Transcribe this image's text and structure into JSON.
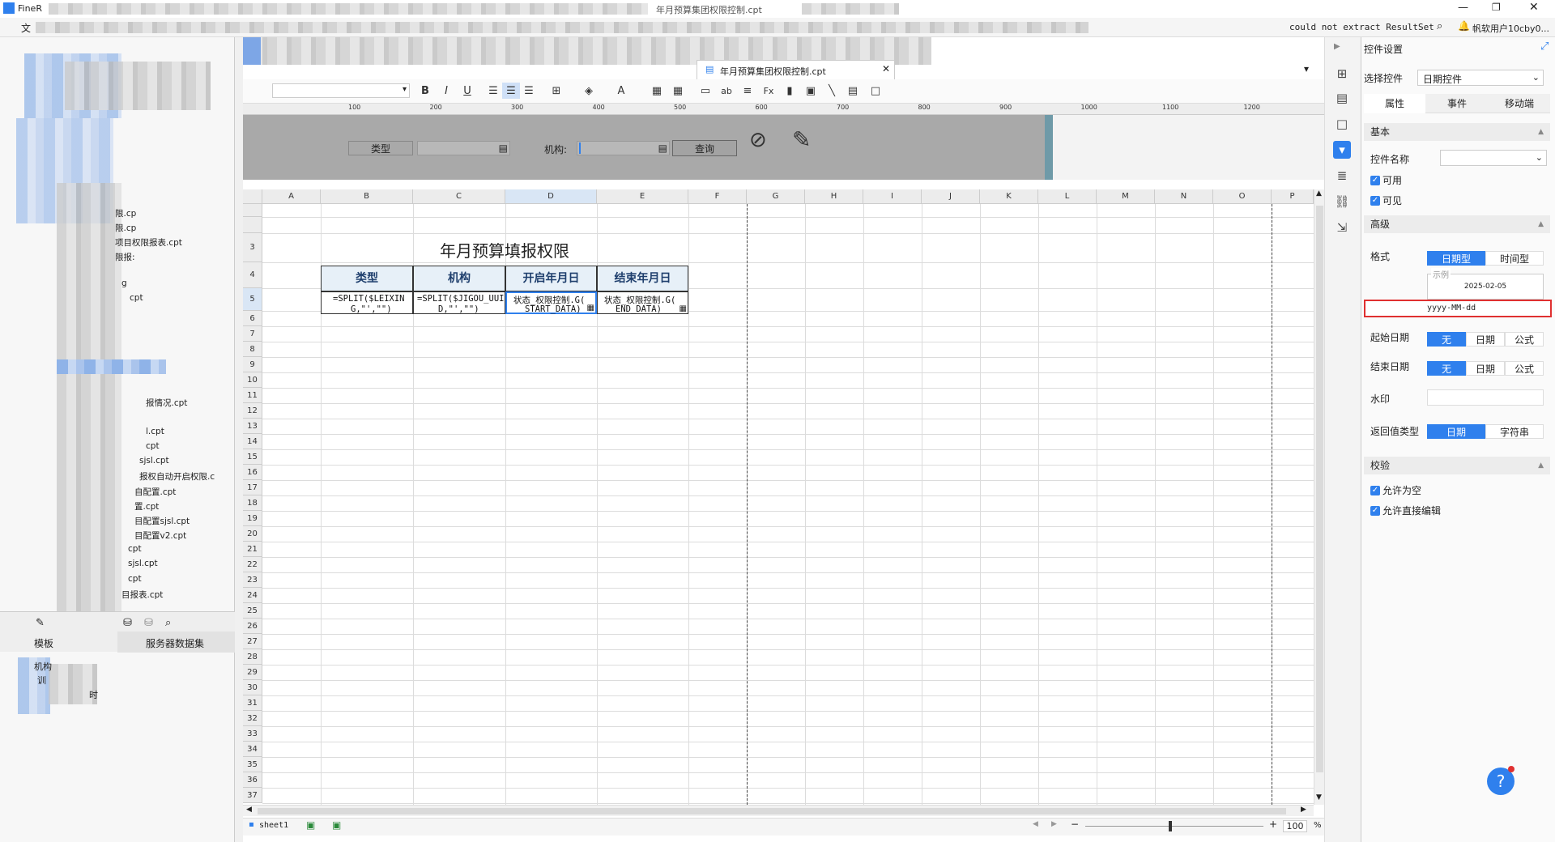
{
  "titlebar": {
    "app": "FineR",
    "title_fragment": "年月预算集团权限控制.cpt",
    "status": "could not extract ResultSet",
    "user": "帆软用户10cby0..."
  },
  "menubar": {
    "first": "文"
  },
  "tab": {
    "name": "年月预算集团权限控制.cpt"
  },
  "ruler": [
    "100",
    "200",
    "300",
    "400",
    "500",
    "600",
    "700",
    "800",
    "900",
    "1000",
    "1100",
    "1200"
  ],
  "param_pane": {
    "label_type": "类型",
    "label_org": "机构:",
    "query_button": "查询"
  },
  "columns": [
    "A",
    "B",
    "C",
    "D",
    "E",
    "F",
    "G",
    "H",
    "I",
    "J",
    "K",
    "L",
    "M",
    "N",
    "O",
    "P"
  ],
  "rows": [
    "",
    "",
    "3",
    "4",
    "5",
    "6",
    "7",
    "8",
    "9",
    "10",
    "11",
    "12",
    "13",
    "14",
    "15",
    "16",
    "17",
    "18",
    "19",
    "20",
    "21",
    "22",
    "23",
    "24",
    "25",
    "26",
    "27",
    "28",
    "29",
    "30",
    "31",
    "32",
    "33",
    "34",
    "35",
    "36",
    "37"
  ],
  "report": {
    "title": "年月预算填报权限",
    "headers": [
      "类型",
      "机构",
      "开启年月日",
      "结束年月日"
    ],
    "row5": [
      "=SPLIT($LEIXIN",
      "=SPLIT($JIGOU_UUI",
      "状态_权限控制.G(",
      "状态_权限控制.G("
    ],
    "row5b": [
      "G,\"',\"\")",
      "D,\"',\"\")",
      "START_DATA)",
      "END_DATA)"
    ]
  },
  "tree": [
    "限.cp",
    "限.cp",
    "项目权限报表.cpt",
    "限报:",
    "g",
    "cpt",
    "报情况.cpt",
    "l.cpt",
    "cpt",
    "sjsl.cpt",
    "报权自动开启权限.c",
    "自配置.cpt",
    "置.cpt",
    "目配置sjsl.cpt",
    "目配置v2.cpt",
    "cpt",
    "sjsl.cpt",
    "cpt",
    "目报表.cpt"
  ],
  "left_tabs": {
    "template": "模板",
    "server_dataset": "服务器数据集"
  },
  "bottom_tree": [
    "机构",
    "训",
    "时"
  ],
  "sheet": {
    "name": "sheet1",
    "zoom": "100",
    "percent": "%"
  },
  "props": {
    "title": "控件设置",
    "select_label": "选择控件",
    "select_value": "日期控件",
    "tabs": [
      "属性",
      "事件",
      "移动端"
    ],
    "basic": "基本",
    "name_label": "控件名称",
    "enabled": "可用",
    "visible": "可见",
    "advanced": "高级",
    "format_label": "格式",
    "format_opts": [
      "日期型",
      "时间型"
    ],
    "example_label": "示例",
    "example_value": "2025-02-05",
    "format_value": "yyyy-MM-dd",
    "start_label": "起始日期",
    "end_label": "结束日期",
    "date_opts": [
      "无",
      "日期",
      "公式"
    ],
    "watermark_label": "水印",
    "return_label": "返回值类型",
    "return_opts": [
      "日期",
      "字符串"
    ],
    "validate": "校验",
    "allow_empty": "允许为空",
    "allow_edit": "允许直接编辑"
  },
  "help": "?",
  "colors": {
    "accent": "#2f80ed",
    "highlight": "#e03030"
  }
}
